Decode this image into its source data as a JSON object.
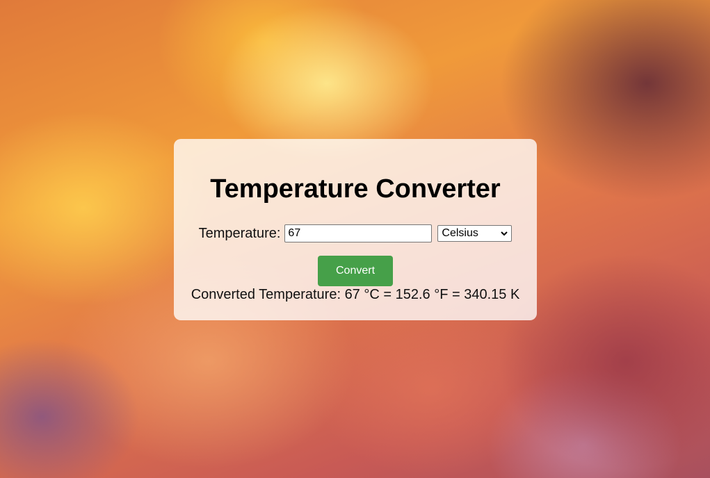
{
  "converter": {
    "title": "Temperature Converter",
    "input_label": "Temperature:",
    "input_value": "67",
    "unit_selected": "Celsius",
    "button_label": "Convert",
    "result_text": "Converted Temperature: 67 °C = 152.6 °F = 340.15 K"
  },
  "colors": {
    "button": "#46a049",
    "card": "rgba(255,255,255,0.78)"
  },
  "icons": {
    "select_arrow": "chevron-down-icon"
  }
}
